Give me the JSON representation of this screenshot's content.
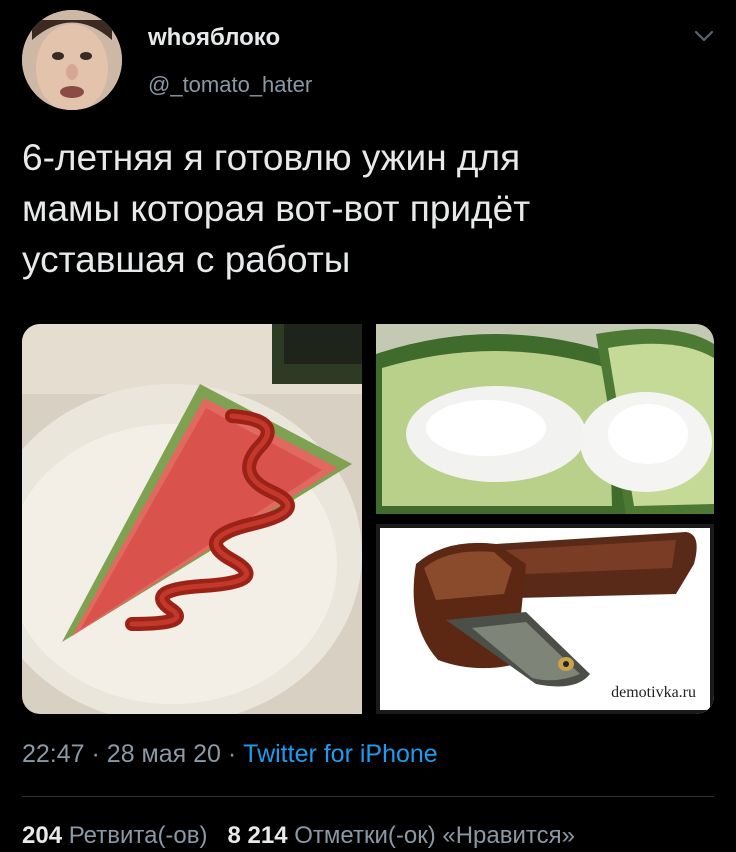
{
  "author": {
    "display_name": "whoяблоко",
    "handle": "@_tomato_hater",
    "avatar_icon": "profile-photo"
  },
  "tweet": {
    "text": "6-летняя я готовлю ужин для\nмамы которая вот-вот придёт\nуставшая с работы"
  },
  "media": {
    "watermark": "demotivka.ru"
  },
  "meta": {
    "time": "22:47",
    "separator": "·",
    "date": "28 мая 20",
    "source": "Twitter for iPhone"
  },
  "stats": {
    "retweets_count": "204",
    "retweets_label": "Ретвита(-ов)",
    "likes_count": "8 214",
    "likes_label": "Отметки(-ок) «Нравится»"
  },
  "colors": {
    "background": "#000000",
    "text_primary": "#e7e9ea",
    "text_secondary": "#8b98a5",
    "link": "#1d9bf0",
    "divider": "#2f3336"
  }
}
